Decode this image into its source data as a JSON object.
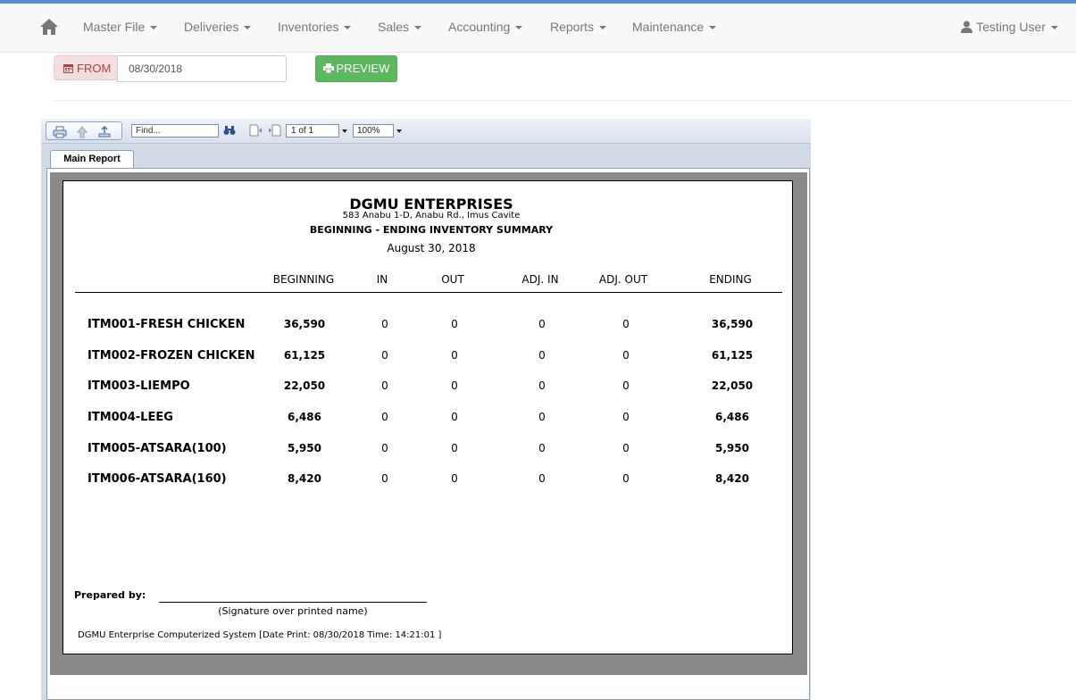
{
  "navbar": {
    "home_icon": "home-icon",
    "menus": [
      "Master File",
      "Deliveries",
      "Inventories",
      "Sales",
      "Accounting",
      "Reports",
      "Maintenance"
    ],
    "user": "Testing User"
  },
  "filter": {
    "from_label": "FROM",
    "from_value": "08/30/2018",
    "preview_label": "PREVIEW"
  },
  "viewer": {
    "find_placeholder": "Find...",
    "page": "1 of 1",
    "zoom": "100%",
    "tab": "Main Report"
  },
  "report": {
    "company": "DGMU ENTERPRISES",
    "address": "583 Anabu 1-D, Anabu Rd., Imus Cavite",
    "title": "BEGINNING - ENDING INVENTORY SUMMARY",
    "date": "August 30, 2018",
    "columns": [
      "BEGINNING",
      "IN",
      "OUT",
      "ADJ. IN",
      "ADJ. OUT",
      "ENDING"
    ],
    "rows": [
      {
        "item": "ITM001-FRESH CHICKEN",
        "beginning": "36,590",
        "in": "0",
        "out": "0",
        "adj_in": "0",
        "adj_out": "0",
        "ending": "36,590"
      },
      {
        "item": "ITM002-FROZEN CHICKEN",
        "beginning": "61,125",
        "in": "0",
        "out": "0",
        "adj_in": "0",
        "adj_out": "0",
        "ending": "61,125"
      },
      {
        "item": "ITM003-LIEMPO",
        "beginning": "22,050",
        "in": "0",
        "out": "0",
        "adj_in": "0",
        "adj_out": "0",
        "ending": "22,050"
      },
      {
        "item": "ITM004-LEEG",
        "beginning": "6,486",
        "in": "0",
        "out": "0",
        "adj_in": "0",
        "adj_out": "0",
        "ending": "6,486"
      },
      {
        "item": "ITM005-ATSARA(100)",
        "beginning": "5,950",
        "in": "0",
        "out": "0",
        "adj_in": "0",
        "adj_out": "0",
        "ending": "5,950"
      },
      {
        "item": "ITM006-ATSARA(160)",
        "beginning": "8,420",
        "in": "0",
        "out": "0",
        "adj_in": "0",
        "adj_out": "0",
        "ending": "8,420"
      }
    ],
    "prepared_by": "Prepared by:",
    "signature_caption": "(Signature over printed name)",
    "footer": "DGMU Enterprise Computerized System  [Date Print: 08/30/2018 Time: 14:21:01 ]"
  },
  "colors": {
    "success": "#5cb85c",
    "danger_text": "#a94442",
    "navbar_text": "#777777"
  }
}
